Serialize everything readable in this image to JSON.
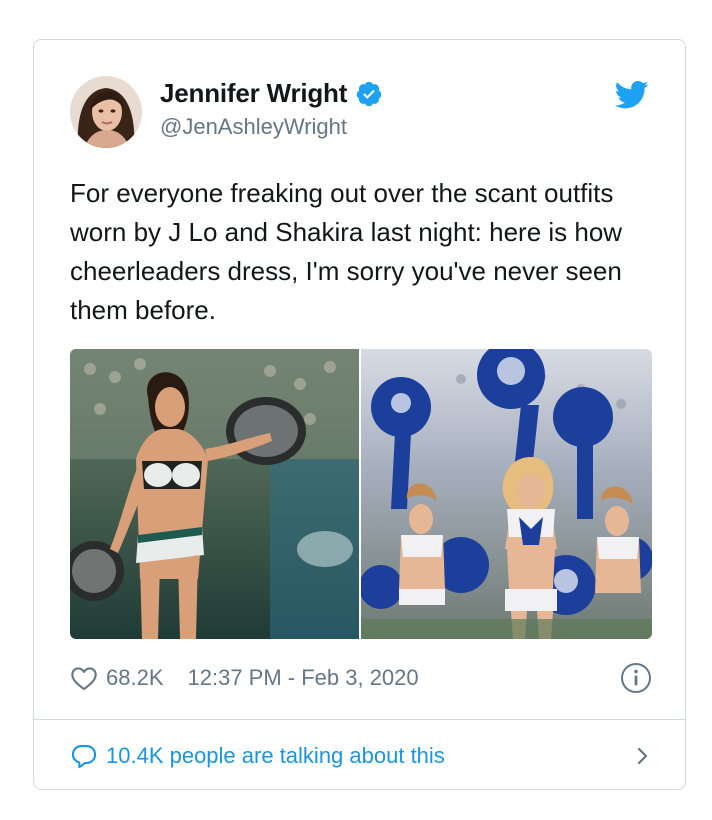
{
  "tweet": {
    "author": {
      "display_name": "Jennifer Wright",
      "handle": "@JenAshleyWright",
      "verified": true
    },
    "text": "For everyone freaking out over the scant outfits worn by J Lo and Shakira last night: here is how cheerleaders dress, I'm sorry you've never seen them before.",
    "likes": "68.2K",
    "timestamp": "12:37 PM - Feb 3, 2020",
    "talking": "10.4K people are talking about this"
  },
  "icons": {
    "verified": "verified-badge-icon",
    "brand": "twitter-bird-icon",
    "like": "heart-icon",
    "info": "info-icon",
    "reply": "speech-bubble-icon",
    "more": "chevron-right-icon"
  },
  "colors": {
    "brand_blue": "#1da1f2",
    "link_blue": "#1b95e0",
    "secondary_text": "#657786",
    "border": "#cfd9de"
  }
}
